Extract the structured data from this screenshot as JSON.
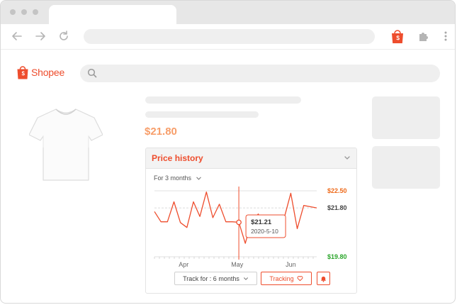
{
  "colors": {
    "accent": "#ee4d2d",
    "price": "#f79e6a",
    "high": "#ee6a1a",
    "low": "#2ba62b"
  },
  "shop": {
    "name": "Shopee"
  },
  "product": {
    "price": "$21.80"
  },
  "price_history": {
    "title": "Price history",
    "range_label": "For 3 months",
    "track_label": "Track for : 6 months",
    "tracking_label": "Tracking",
    "tooltip": {
      "price": "$21.21",
      "date": "2020-5-10"
    }
  },
  "chart_data": {
    "type": "line",
    "xlabel": "",
    "ylabel": "",
    "ylim": [
      19.8,
      22.5
    ],
    "x_ticks": [
      "Apr",
      "May",
      "Jun"
    ],
    "y_labels": [
      {
        "value": 22.5,
        "label": "$22.50",
        "kind": "high"
      },
      {
        "value": 21.8,
        "label": "$21.80",
        "kind": "current"
      },
      {
        "value": 19.8,
        "label": "$19.80",
        "kind": "low"
      }
    ],
    "series": [
      {
        "values": [
          21.65,
          21.23,
          21.23,
          22.05,
          21.2,
          21.0,
          22.05,
          21.45,
          22.45,
          21.4,
          21.95,
          21.23,
          21.23,
          21.21,
          20.35,
          21.3,
          21.55,
          20.85,
          20.9,
          20.85,
          21.4,
          22.4,
          20.95,
          21.9,
          21.85,
          21.8
        ]
      }
    ],
    "highlight": {
      "index": 13,
      "value": 21.21,
      "date": "2020-5-10"
    }
  }
}
